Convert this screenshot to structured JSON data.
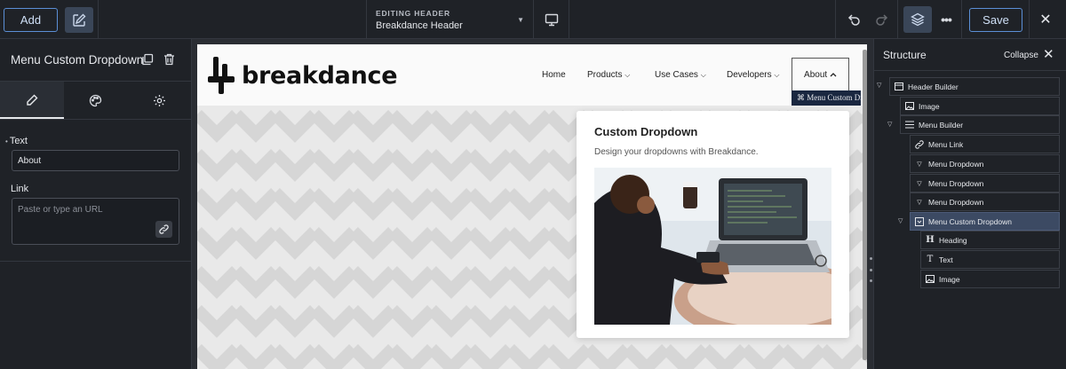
{
  "toolbar": {
    "add_label": "Add",
    "editing_label": "EDITING HEADER",
    "editing_title": "Breakdance Header",
    "save_label": "Save"
  },
  "left_panel": {
    "title": "Menu Custom Dropdown",
    "text_label": "Text",
    "text_value": "About",
    "link_label": "Link",
    "link_placeholder": "Paste or type an URL"
  },
  "site": {
    "logo_text": "breakdance",
    "nav": [
      {
        "label": "Home",
        "has_caret": false
      },
      {
        "label": "Products",
        "has_caret": true
      },
      {
        "label": "Use Cases",
        "has_caret": true
      },
      {
        "label": "Developers",
        "has_caret": true
      }
    ],
    "about_label": "About",
    "selection_tag": "⌘ Menu Custom Dropdown",
    "dropdown": {
      "title": "Custom Dropdown",
      "text": "Design your dropdowns with Breakdance."
    }
  },
  "structure": {
    "title": "Structure",
    "collapse_label": "Collapse",
    "items": [
      {
        "label": "Header Builder",
        "icon": "header-icon",
        "toggle": true
      },
      {
        "label": "Image",
        "icon": "image-icon",
        "toggle": false
      },
      {
        "label": "Menu Builder",
        "icon": "menu-icon",
        "toggle": true
      },
      {
        "label": "Menu Link",
        "icon": "link-icon",
        "toggle": false
      },
      {
        "label": "Menu Dropdown",
        "icon": "dropdown-icon",
        "toggle": false
      },
      {
        "label": "Menu Dropdown",
        "icon": "dropdown-icon",
        "toggle": false
      },
      {
        "label": "Menu Dropdown",
        "icon": "dropdown-icon",
        "toggle": false
      },
      {
        "label": "Menu Custom Dropdown",
        "icon": "custom-dropdown-icon",
        "toggle": true,
        "selected": true
      },
      {
        "label": "Heading",
        "icon": "heading-icon",
        "toggle": false
      },
      {
        "label": "Text",
        "icon": "text-icon",
        "toggle": false
      },
      {
        "label": "Image",
        "icon": "image-icon",
        "toggle": false
      }
    ]
  },
  "colors": {
    "accent": "#5b8fd6",
    "selected_row": "#3c4a63",
    "panel_bg": "#1f2227"
  }
}
